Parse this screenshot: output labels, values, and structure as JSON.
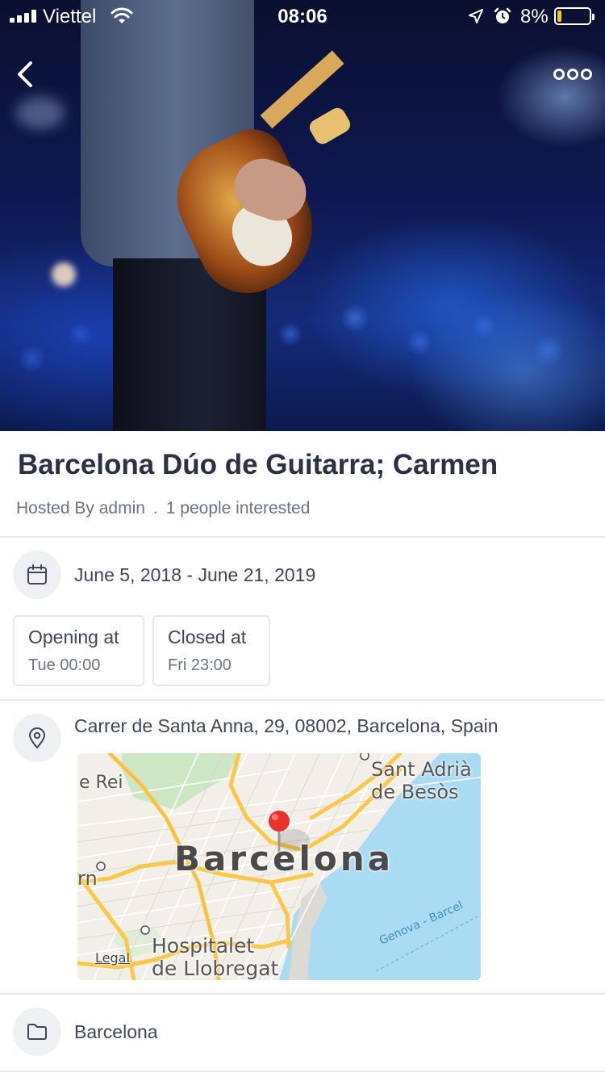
{
  "status_bar": {
    "carrier": "Viettel",
    "time": "08:06",
    "battery": "8%",
    "battery_level": 0.08,
    "icons": [
      "signal-icon",
      "wifi-icon",
      "location-arrow-icon",
      "alarm-icon",
      "battery-icon"
    ]
  },
  "nav": {
    "back_icon": "chevron-left-icon",
    "more_icon": "more-dots-icon"
  },
  "event": {
    "title": "Barcelona Dúo de Guitarra; Carmen",
    "hosted_by": "Hosted By admin",
    "separator": ".",
    "interested": "1 people interested",
    "date_range": "June 5, 2018 - June 21, 2019",
    "opening_label": "Opening at",
    "opening_value": "Tue 00:00",
    "closed_label": "Closed at",
    "closed_value": "Fri 23:00",
    "address": "Carrer de Santa Anna, 29, 08002, Barcelona, Spain",
    "category": "Barcelona"
  },
  "map": {
    "labels": {
      "city": "Barcelona",
      "sant_adria_1": "Sant Adrià",
      "sant_adria_2": "de Besòs",
      "hospitalet_1": "Hospitalet",
      "hospitalet_2": "de Llobregat",
      "rei": "e Rei",
      "rn": "rn",
      "ferry": "Genova - Barcel",
      "legal": "Legal"
    },
    "colors": {
      "land": "#f2efe9",
      "water": "#a9dbf3",
      "park": "#cde6c4",
      "highway": "#f9c84a",
      "pin": "#e8322d"
    }
  },
  "colors": {
    "text_primary": "#2b3043",
    "text_secondary": "#6e7482",
    "divider": "#e9eaee",
    "icon_bg": "#eef0f3"
  }
}
